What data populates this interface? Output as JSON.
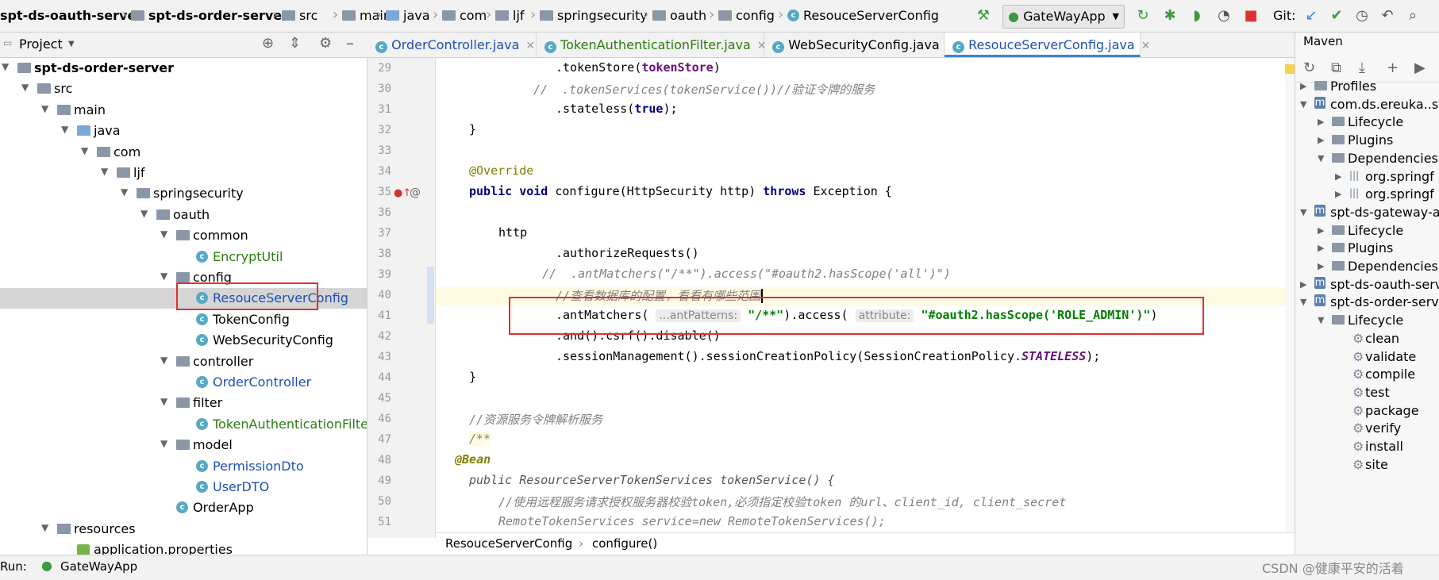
{
  "navbar": {
    "crumbs": [
      "spt-ds-oauth-server",
      "spt-ds-order-server",
      "src",
      "main",
      "java",
      "com",
      "ljf",
      "springsecurity",
      "oauth",
      "config",
      "ResouceServerConfig"
    ],
    "run_config": "GateWayApp",
    "git_label": "Git:"
  },
  "project": {
    "title": "Project",
    "tree": [
      {
        "label": "spt-ds-order-server",
        "depth": 0,
        "open": true,
        "icon": "module",
        "bold": true
      },
      {
        "label": "src",
        "depth": 1,
        "open": true,
        "icon": "folder"
      },
      {
        "label": "main",
        "depth": 2,
        "open": true,
        "icon": "folder"
      },
      {
        "label": "java",
        "depth": 3,
        "open": true,
        "icon": "folder-blue"
      },
      {
        "label": "com",
        "depth": 4,
        "open": true,
        "icon": "package"
      },
      {
        "label": "ljf",
        "depth": 5,
        "open": true,
        "icon": "package"
      },
      {
        "label": "springsecurity",
        "depth": 6,
        "open": true,
        "icon": "package"
      },
      {
        "label": "oauth",
        "depth": 7,
        "open": true,
        "icon": "package"
      },
      {
        "label": "common",
        "depth": 8,
        "open": true,
        "icon": "package"
      },
      {
        "label": "EncryptUtil",
        "depth": 9,
        "icon": "class",
        "color": "green"
      },
      {
        "label": "config",
        "depth": 8,
        "open": true,
        "icon": "package"
      },
      {
        "label": "ResouceServerConfig",
        "depth": 9,
        "icon": "class",
        "color": "blue",
        "selected": true
      },
      {
        "label": "TokenConfig",
        "depth": 9,
        "icon": "class"
      },
      {
        "label": "WebSecurityConfig",
        "depth": 9,
        "icon": "class"
      },
      {
        "label": "controller",
        "depth": 8,
        "open": true,
        "icon": "package"
      },
      {
        "label": "OrderController",
        "depth": 9,
        "icon": "class",
        "color": "blue"
      },
      {
        "label": "filter",
        "depth": 8,
        "open": true,
        "icon": "package"
      },
      {
        "label": "TokenAuthenticationFilter",
        "depth": 9,
        "icon": "class",
        "color": "green"
      },
      {
        "label": "model",
        "depth": 8,
        "open": true,
        "icon": "package"
      },
      {
        "label": "PermissionDto",
        "depth": 9,
        "icon": "class",
        "color": "blue"
      },
      {
        "label": "UserDTO",
        "depth": 9,
        "icon": "class",
        "color": "blue"
      },
      {
        "label": "OrderApp",
        "depth": 8,
        "icon": "class-run"
      },
      {
        "label": "resources",
        "depth": 2,
        "open": true,
        "icon": "folder-res"
      },
      {
        "label": "application.properties",
        "depth": 3,
        "icon": "props"
      }
    ]
  },
  "tabs": [
    {
      "label": "OrderController.java",
      "color": "blue"
    },
    {
      "label": "TokenAuthenticationFilter.java",
      "color": "green"
    },
    {
      "label": "WebSecurityConfig.java",
      "color": "black"
    },
    {
      "label": "ResouceServerConfig.java",
      "color": "blue",
      "active": true
    }
  ],
  "code": {
    "line_numbers": [
      "29",
      "30",
      "31",
      "32",
      "33",
      "34",
      "35",
      "36",
      "37",
      "38",
      "39",
      "40",
      "41",
      "42",
      "43",
      "44",
      "45",
      "46",
      "47",
      "48",
      "49",
      "50",
      "51"
    ],
    "l29a": ".tokenStore(",
    "l29b": "tokenStore",
    "l29c": ")",
    "l30": "//  .tokenServices(tokenService())//验证令牌的服务",
    "l31a": ".stateless(",
    "l31b": "true",
    "l31c": ");",
    "l32": "}",
    "l34": "@Override",
    "l35a": "public void",
    "l35b": " configure(HttpSecurity http) ",
    "l35c": "throws",
    "l35d": " Exception {",
    "l37": "http",
    "l38": ".authorizeRequests()",
    "l39": "//  .antMatchers(\"/**\").access(\"#oauth2.hasScope('all')\")",
    "l40": "//查看数据库的配置，看看有哪些范围",
    "l41a": ".antMatchers(",
    "l41hint1": "...antPatterns:",
    "l41b": "\"/**\"",
    "l41c": ").access(",
    "l41hint2": "attribute:",
    "l41d": "\"#oauth2.hasScope('",
    "l41e": "ROLE_ADMIN",
    "l41f": "')\"",
    "l41g": ")",
    "l42": ".and().csrf().disable()",
    "l43a": ".sessionManagement().sessionCreationPolicy(SessionCreationPolicy.",
    "l43b": "STATELESS",
    "l43c": ");",
    "l44": "}",
    "l46": "//资源服务令牌解析服务",
    "l47": "/**",
    "l48": "@Bean",
    "l49": "public ResourceServerTokenServices tokenService() {",
    "l50": "//使用远程服务请求授权服务器校验token,必须指定校验token 的url、client_id, client_secret",
    "l51": "RemoteTokenServices service=new RemoteTokenServices();"
  },
  "editor_breadcrumb": {
    "class": "ResouceServerConfig",
    "method": "configure()"
  },
  "maven": {
    "title": "Maven",
    "items": [
      {
        "label": "Profiles",
        "depth": 0,
        "arrow": "right",
        "icon": "folder"
      },
      {
        "label": "com.ds.ereuka..se",
        "depth": 0,
        "arrow": "down",
        "icon": "maven"
      },
      {
        "label": "Lifecycle",
        "depth": 1,
        "arrow": "right",
        "icon": "folder-gear"
      },
      {
        "label": "Plugins",
        "depth": 1,
        "arrow": "right",
        "icon": "folder-gear"
      },
      {
        "label": "Dependencies",
        "depth": 1,
        "arrow": "down",
        "icon": "folder-dep"
      },
      {
        "label": "org.springf",
        "depth": 2,
        "arrow": "right",
        "icon": "lib"
      },
      {
        "label": "org.springf",
        "depth": 2,
        "arrow": "right",
        "icon": "lib"
      },
      {
        "label": "spt-ds-gateway-ap",
        "depth": 0,
        "arrow": "down",
        "icon": "maven"
      },
      {
        "label": "Lifecycle",
        "depth": 1,
        "arrow": "right",
        "icon": "folder-gear"
      },
      {
        "label": "Plugins",
        "depth": 1,
        "arrow": "right",
        "icon": "folder-gear"
      },
      {
        "label": "Dependencies",
        "depth": 1,
        "arrow": "right",
        "icon": "folder-dep"
      },
      {
        "label": "spt-ds-oauth-serv",
        "depth": 0,
        "arrow": "right",
        "icon": "maven"
      },
      {
        "label": "spt-ds-order-serv",
        "depth": 0,
        "arrow": "down",
        "icon": "maven"
      },
      {
        "label": "Lifecycle",
        "depth": 1,
        "arrow": "down",
        "icon": "folder-gear"
      },
      {
        "label": "clean",
        "depth": 2,
        "icon": "gear"
      },
      {
        "label": "validate",
        "depth": 2,
        "icon": "gear"
      },
      {
        "label": "compile",
        "depth": 2,
        "icon": "gear"
      },
      {
        "label": "test",
        "depth": 2,
        "icon": "gear"
      },
      {
        "label": "package",
        "depth": 2,
        "icon": "gear"
      },
      {
        "label": "verify",
        "depth": 2,
        "icon": "gear"
      },
      {
        "label": "install",
        "depth": 2,
        "icon": "gear"
      },
      {
        "label": "site",
        "depth": 2,
        "icon": "gear"
      }
    ]
  },
  "bottom": {
    "run_label": "Run:",
    "run_target": "GateWayApp",
    "watermark": "CSDN @健康平安的活着"
  },
  "colors": {
    "accent": "#4083c9",
    "highlight_box": "#e03030",
    "selection": "#d5d5d5"
  }
}
